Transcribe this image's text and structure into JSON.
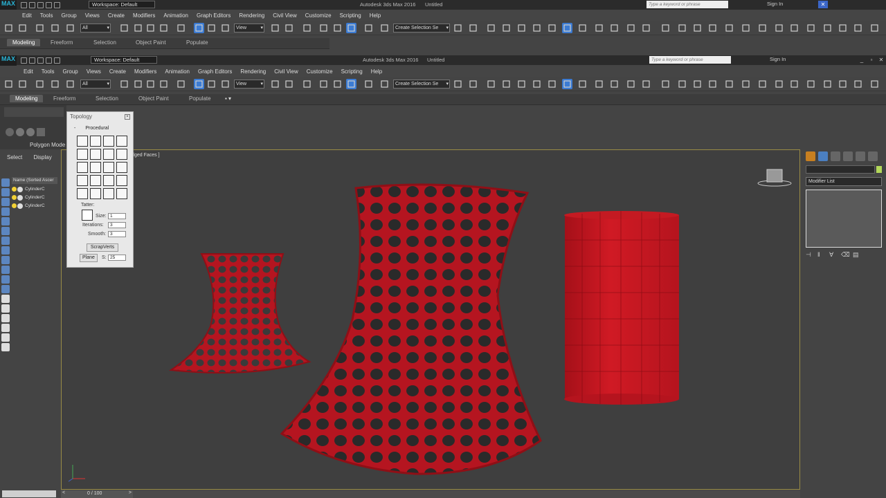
{
  "app": {
    "title": "Autodesk 3ds Max 2016",
    "doc": "Untitled",
    "workspace": "Workspace: Default",
    "search_placeholder": "Type a keyword or phrase",
    "signin": "Sign In",
    "logo": "MAX"
  },
  "menu": [
    "Edit",
    "Tools",
    "Group",
    "Views",
    "Create",
    "Modifiers",
    "Animation",
    "Graph Editors",
    "Rendering",
    "Civil View",
    "Customize",
    "Scripting",
    "Help"
  ],
  "toolbar": {
    "filter": "All",
    "refcoord": "View",
    "selection_set": "Create Selection Se",
    "snap_label": "3",
    "snap_label2": "n"
  },
  "ribbon": {
    "tabs": [
      "Modeling",
      "Freeform",
      "Selection",
      "Object Paint",
      "Populate"
    ],
    "active": "Modeling",
    "panel_label": "Polygon Mode"
  },
  "leftpanel": {
    "tab_select": "Select",
    "tab_display": "Display",
    "header": "Name (Sorted Ascer",
    "rows": [
      "CylinderC",
      "CylinderC",
      "CylinderC"
    ]
  },
  "viewport": {
    "label_suffix": "dged Faces ]",
    "label_prefix": "[+"
  },
  "topology": {
    "title": "Topology",
    "section": "Procedural",
    "collapse": "-",
    "tatter": "Tatter:",
    "size_label": "Size:",
    "size_value": "1",
    "iter_label": "Iterations:",
    "iter_value": "3",
    "smooth_label": "Smooth:",
    "smooth_value": "3",
    "scrap": "ScrapVerts",
    "plane": "Plane",
    "s_label": "S:",
    "s_value": "25"
  },
  "rightpanel": {
    "modifier_list": "Modifier List"
  },
  "timeline": {
    "value": "0 / 100"
  },
  "colors": {
    "object_red": "#c8141e",
    "viewport_border": "#9a8c45",
    "active_button": "#3b7bd3"
  }
}
